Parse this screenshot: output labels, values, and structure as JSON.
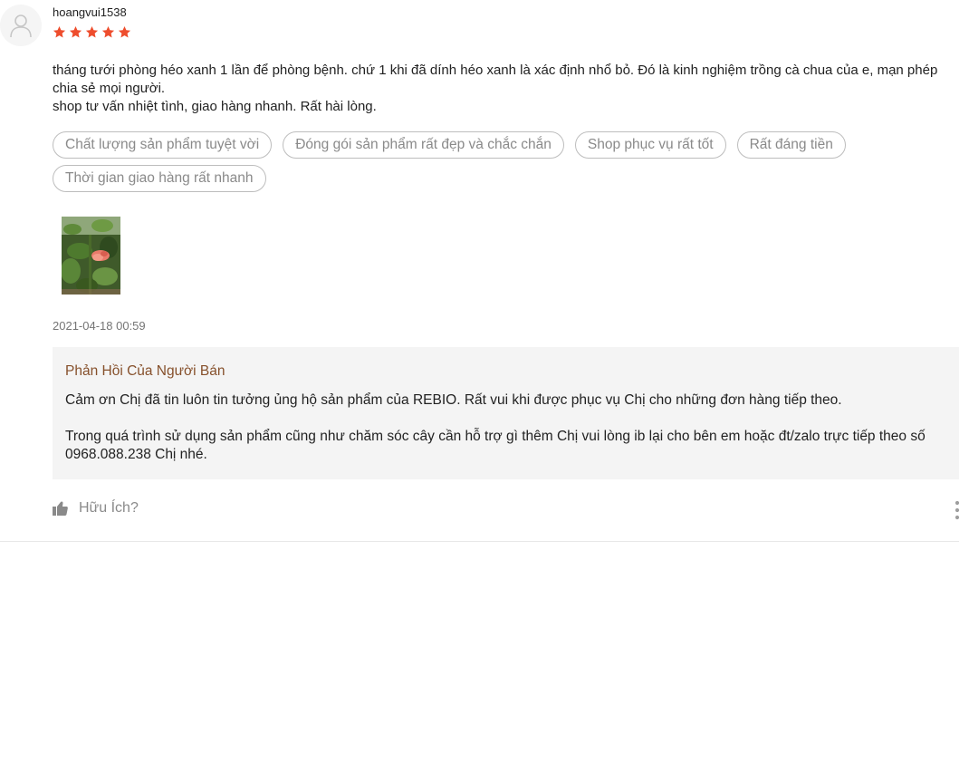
{
  "review": {
    "username": "hoangvui1538",
    "rating": 5,
    "rating_max": 5,
    "star_color": "#ee4d2d",
    "text_lines": [
      "tháng tưới phòng héo xanh 1 lần để phòng bệnh. chứ 1 khi đã dính héo xanh là xác định nhổ bỏ. Đó là kinh nghiệm trồng cà chua của e, mạn phép chia sẻ mọi người.",
      "shop tư vấn nhiệt tình, giao hàng nhanh. Rất hài lòng."
    ],
    "tags": [
      "Chất lượng sản phẩm tuyệt vời",
      "Đóng gói sản phẩm rất đẹp và chắc chắn",
      "Shop phục vụ rất tốt",
      "Rất đáng tiền",
      "Thời gian giao hàng rất nhanh"
    ],
    "timestamp": "2021-04-18 00:59"
  },
  "seller_reply": {
    "title": "Phản Hồi Của Người Bán",
    "paragraphs": [
      "Cảm ơn Chị đã tin luôn tin tưởng ủng hộ sản phẩm của REBIO. Rất vui khi được phục vụ Chị cho những đơn hàng tiếp theo.",
      "Trong quá trình sử dụng sản phẩm cũng như chăm sóc cây cần hỗ trợ gì thêm Chị vui lòng ib lại cho bên em hoặc đt/zalo trực tiếp theo số 0968.088.238 Chị nhé."
    ]
  },
  "actions": {
    "helpful_label": "Hữu Ích?"
  },
  "icons": {
    "avatar": "user-avatar-icon",
    "star": "star-icon",
    "thumbs_up": "thumbs-up-icon",
    "more": "more-vertical-icon"
  }
}
